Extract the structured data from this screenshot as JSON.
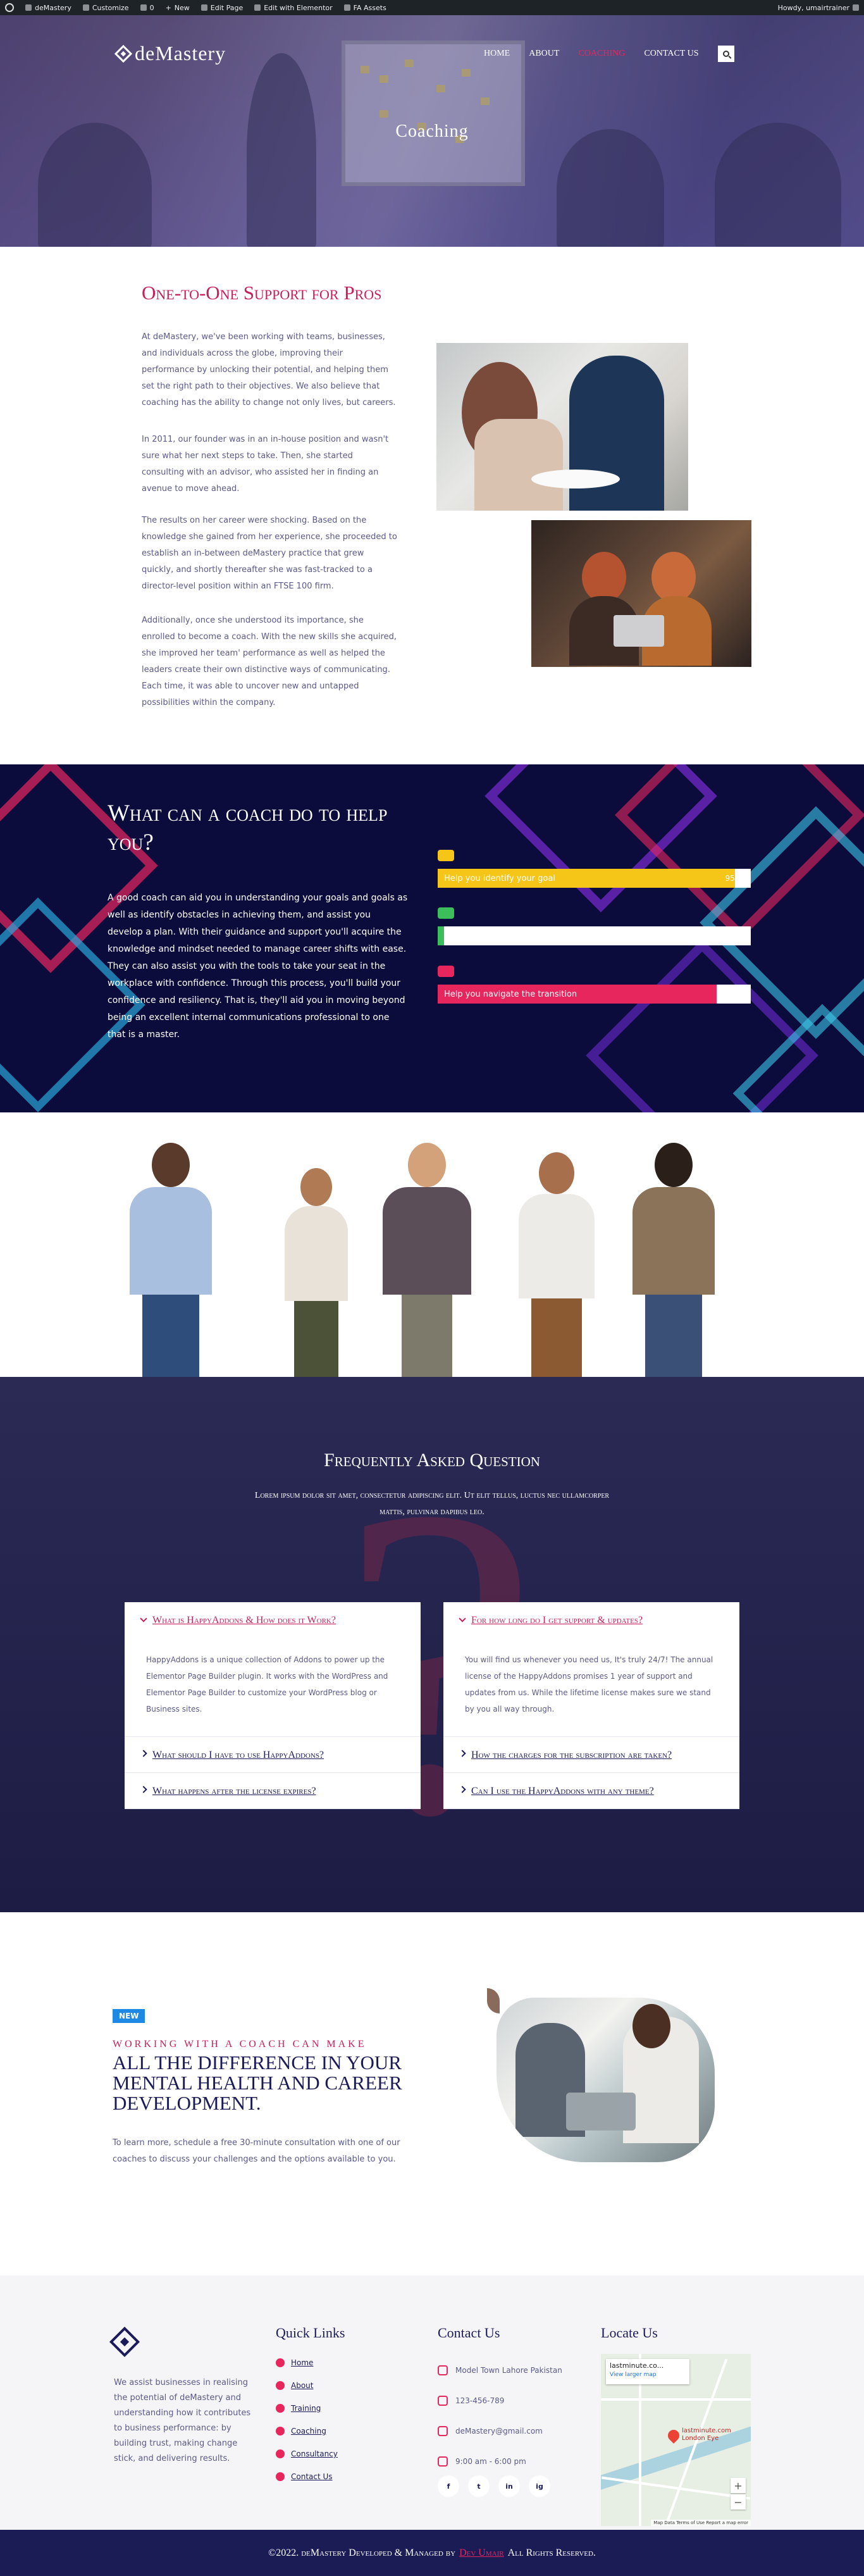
{
  "adminbar": {
    "site": "deMastery",
    "customize": "Customize",
    "comments": "0",
    "new": "New",
    "edit_page": "Edit Page",
    "edit_elementor": "Edit with Elementor",
    "fa_assets": "FA Assets",
    "howdy": "Howdy, umairtrainer"
  },
  "header": {
    "logo": "deMastery",
    "nav": [
      "HOME",
      "ABOUT",
      "COACHING",
      "CONTACT US"
    ],
    "active_index": 2,
    "hero_title": "Coaching"
  },
  "support": {
    "title": "One-to-One Support for Pros",
    "paragraphs": [
      "At deMastery, we've been working with teams, businesses, and individuals across the globe, improving their performance by unlocking their potential, and helping them set the right path to their objectives. We also believe that coaching has the ability to change not only lives, but careers.",
      "In 2011, our founder was in an in-house position and wasn't sure what her next steps to take. Then, she started consulting with an advisor, who assisted her in finding an avenue to move ahead.",
      "The results on her career were shocking. Based on the knowledge she gained from her experience, she proceeded to establish an in-between deMastery practice that grew quickly, and shortly thereafter she was fast-tracked to a director-level position within an FTSE 100 firm.",
      "Additionally, once she understood its importance, she enrolled to become a coach. With the new skills she acquired, she improved her team' performance as well as helped the leaders create their own distinctive ways of communicating. Each time, it was able to uncover new and untapped possibilities within the company."
    ]
  },
  "coach": {
    "title": "What can a coach do to help you?",
    "text": "A good coach can aid you in understanding your goals and goals as well as identify obstacles in achieving them, and assist you develop a plan. With their guidance and support you'll acquire the knowledge and mindset needed to manage career shifts with ease. They can also assist you with the tools to take your seat in the workplace with confidence. Through this process, you'll build your confidence and resiliency. That is, they'll aid you in moving beyond being an excellent internal communications professional to one that is a master.",
    "skills": [
      {
        "label": "Help you identify your goal",
        "percent": 95,
        "percent_text": "95 %",
        "color": "#f5c518",
        "icon": "bulldozer-icon"
      },
      {
        "label": "",
        "percent": 0,
        "percent_text": "",
        "color": "#3cbf5a",
        "icon": "briefcase-icon"
      },
      {
        "label": "Help you navigate the transition",
        "percent": 89,
        "percent_text": "89 %",
        "color": "#e8265e",
        "icon": "piggy-bank-icon"
      }
    ]
  },
  "faq": {
    "title": "Frequently Asked Question",
    "subtitle": "Lorem ipsum dolor sit amet, consectetur adipiscing elit. Ut elit tellus, luctus nec ullamcorper mattis, pulvinar dapibus leo.",
    "left": [
      {
        "q": "What is HappyAddons & How does it Work?",
        "open": true,
        "a": "HappyAddons is a unique collection of Addons to power up the Elementor Page Builder plugin. It works with the WordPress and Elementor Page Builder to customize your WordPress blog or Business sites."
      },
      {
        "q": "What should I have to use HappyAddons?",
        "open": false,
        "a": ""
      },
      {
        "q": "What happens after the license expires?",
        "open": false,
        "a": ""
      }
    ],
    "right": [
      {
        "q": "For how long do I get support & updates?",
        "open": true,
        "a": "You will find us whenever you need us, It's truly 24/7! The annual license of the HappyAddons promises 1 year of support and updates from us. While the lifetime license makes sure we stand by you all way through."
      },
      {
        "q": "How the charges for the subscription are taken?",
        "open": false,
        "a": ""
      },
      {
        "q": "Can I use the HappyAddons with any theme?",
        "open": false,
        "a": ""
      }
    ]
  },
  "cta": {
    "badge": "NEW",
    "kicker": "WORKING WITH A COACH CAN MAKE",
    "title": "ALL THE DIFFERENCE IN YOUR MENTAL HEALTH AND CAREER DEVELOPMENT.",
    "text": "To learn more, schedule a free 30-minute consultation with one of our coaches to discuss your challenges and the options available to you."
  },
  "footer": {
    "about": "We assist businesses in realising the potential of deMastery and understanding how it contributes to business performance: by building trust, making change stick, and delivering results.",
    "quick_links_title": "Quick Links",
    "quick_links": [
      "Home",
      "About",
      "Training",
      "Coaching",
      "Consultancy",
      "Contact Us"
    ],
    "contact_title": "Contact Us",
    "contact": [
      "Model Town Lahore Pakistan",
      "123-456-789",
      "deMastery@gmail.com",
      "9:00 am - 6:00 pm"
    ],
    "social": [
      "f",
      "t",
      "in",
      "ig"
    ],
    "locate_title": "Locate Us",
    "map": {
      "card_title": "lastminute.co...",
      "card_link": "View larger map",
      "pin_label": "lastminute.com London Eye",
      "attribution": "Map Data   Terms of Use   Report a map error"
    },
    "copyright_prefix": "©2022. deMastery Developed & Managed by",
    "developer": "Dev Umair",
    "copyright_suffix": "All Rights Reserved."
  },
  "colors": {
    "accent": "#e8265e",
    "navy": "#1b1b5a",
    "dark": "#0b0b3c"
  }
}
